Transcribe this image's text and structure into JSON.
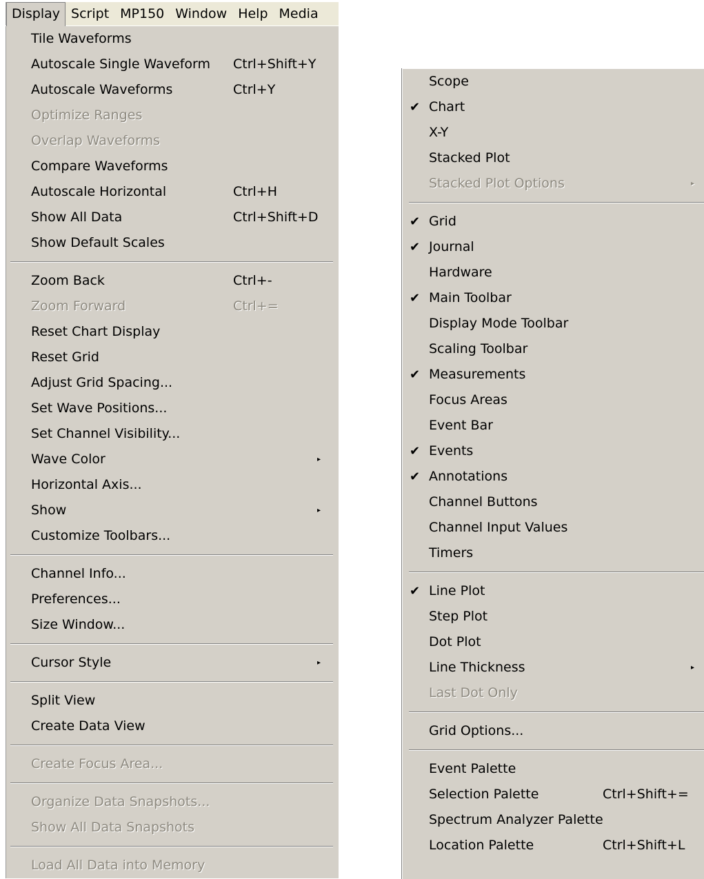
{
  "menubar": [
    "Display",
    "Script",
    "MP150",
    "Window",
    "Help",
    "Media"
  ],
  "left_menu": [
    {
      "label": "Tile Waveforms"
    },
    {
      "label": "Autoscale Single Waveform",
      "shortcut": "Ctrl+Shift+Y"
    },
    {
      "label": "Autoscale Waveforms",
      "shortcut": "Ctrl+Y"
    },
    {
      "label": "Optimize Ranges",
      "disabled": true
    },
    {
      "label": "Overlap Waveforms",
      "disabled": true
    },
    {
      "label": "Compare Waveforms"
    },
    {
      "label": "Autoscale Horizontal",
      "shortcut": "Ctrl+H"
    },
    {
      "label": "Show All Data",
      "shortcut": "Ctrl+Shift+D"
    },
    {
      "label": "Show Default Scales"
    },
    {
      "sep": true
    },
    {
      "label": "Zoom Back",
      "shortcut": "Ctrl+-"
    },
    {
      "label": "Zoom Forward",
      "shortcut": "Ctrl+=",
      "disabled": true
    },
    {
      "label": "Reset Chart Display"
    },
    {
      "label": "Reset Grid"
    },
    {
      "label": "Adjust Grid Spacing..."
    },
    {
      "label": "Set Wave Positions..."
    },
    {
      "label": "Set Channel Visibility..."
    },
    {
      "label": "Wave Color",
      "submenu": true
    },
    {
      "label": "Horizontal Axis..."
    },
    {
      "label": "Show",
      "submenu": true
    },
    {
      "label": "Customize Toolbars..."
    },
    {
      "sep": true
    },
    {
      "label": "Channel Info..."
    },
    {
      "label": "Preferences..."
    },
    {
      "label": "Size Window..."
    },
    {
      "sep": true
    },
    {
      "label": "Cursor Style",
      "submenu": true
    },
    {
      "sep": true
    },
    {
      "label": "Split View"
    },
    {
      "label": "Create Data View"
    },
    {
      "sep": true
    },
    {
      "label": "Create Focus Area...",
      "disabled": true
    },
    {
      "sep": true
    },
    {
      "label": "Organize Data Snapshots...",
      "disabled": true
    },
    {
      "label": "Show All Data Snapshots",
      "disabled": true
    },
    {
      "sep": true
    },
    {
      "label": "Load All Data into Memory",
      "disabled": true
    }
  ],
  "right_menu": [
    {
      "label": "Scope"
    },
    {
      "label": "Chart",
      "checked": true
    },
    {
      "label": "X-Y"
    },
    {
      "label": "Stacked Plot"
    },
    {
      "label": "Stacked Plot Options",
      "disabled": true,
      "submenu": true
    },
    {
      "sep": true
    },
    {
      "label": "Grid",
      "checked": true
    },
    {
      "label": "Journal",
      "checked": true
    },
    {
      "label": "Hardware"
    },
    {
      "label": "Main Toolbar",
      "checked": true
    },
    {
      "label": "Display Mode Toolbar"
    },
    {
      "label": "Scaling Toolbar"
    },
    {
      "label": "Measurements",
      "checked": true
    },
    {
      "label": "Focus Areas"
    },
    {
      "label": "Event Bar"
    },
    {
      "label": "Events",
      "checked": true
    },
    {
      "label": "Annotations",
      "checked": true
    },
    {
      "label": "Channel Buttons"
    },
    {
      "label": "Channel Input Values"
    },
    {
      "label": "Timers"
    },
    {
      "sep": true
    },
    {
      "label": "Line Plot",
      "checked": true
    },
    {
      "label": "Step Plot"
    },
    {
      "label": "Dot Plot"
    },
    {
      "label": "Line Thickness",
      "submenu": true
    },
    {
      "label": "Last Dot Only",
      "disabled": true
    },
    {
      "sep": true
    },
    {
      "label": "Grid Options..."
    },
    {
      "sep": true
    },
    {
      "label": "Event Palette"
    },
    {
      "label": "Selection Palette",
      "shortcut": "Ctrl+Shift+="
    },
    {
      "label": "Spectrum Analyzer Palette"
    },
    {
      "label": "Location Palette",
      "shortcut": "Ctrl+Shift+L"
    }
  ],
  "glyphs": {
    "check": "✔",
    "submenu_arrow": "▸"
  },
  "colors": {
    "menu_bg": "#d4d0c8",
    "menubar_bg": "#ece9d8",
    "disabled_text": "#8e8a80"
  }
}
